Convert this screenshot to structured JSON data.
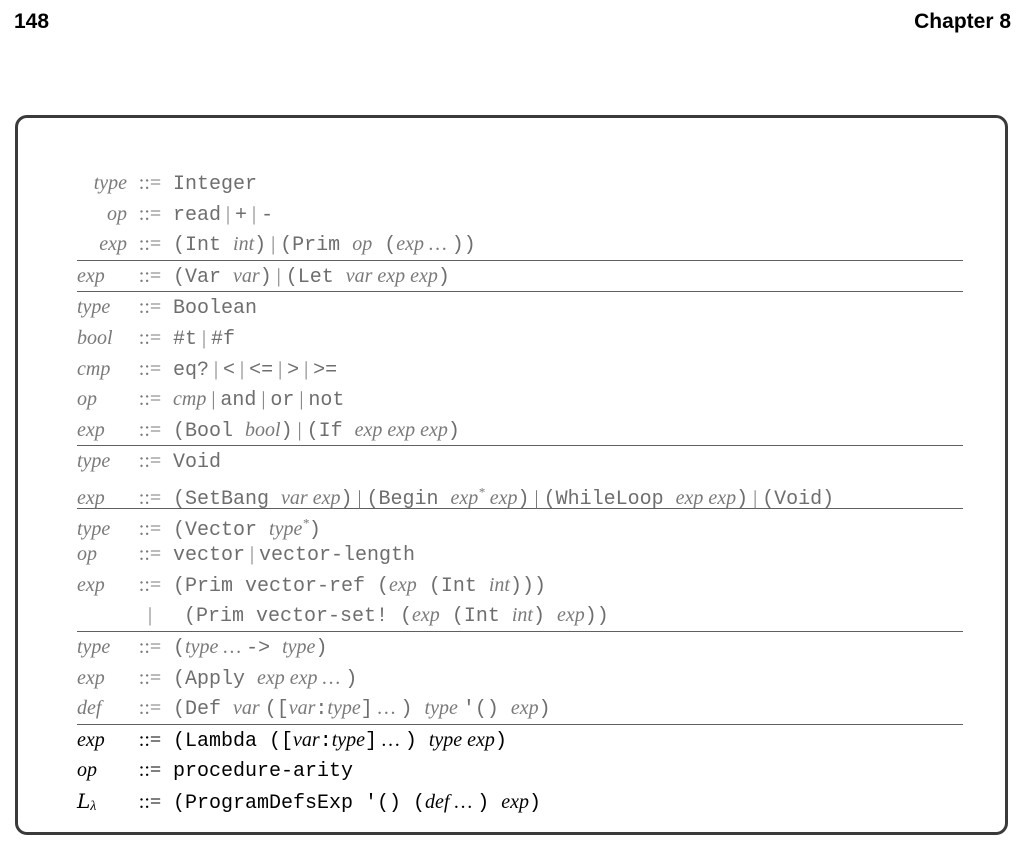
{
  "header": {
    "page_number": "148",
    "chapter": "Chapter 8"
  },
  "grammar": {
    "integers": [
      {
        "lhs": "type",
        "rhs": [
          [
            "mono",
            "Integer"
          ]
        ]
      },
      {
        "lhs": "op",
        "rhs": [
          [
            "mono",
            "read"
          ],
          [
            "sep",
            "|"
          ],
          [
            "mono",
            "+"
          ],
          [
            "sep",
            "|"
          ],
          [
            "mono",
            "-"
          ]
        ]
      },
      {
        "lhs": "exp",
        "rhs": [
          [
            "mono",
            "(Int "
          ],
          [
            "it",
            "int"
          ],
          [
            "mono",
            ")"
          ],
          [
            "sep",
            "|"
          ],
          [
            "mono",
            "(Prim "
          ],
          [
            "it",
            "op"
          ],
          [
            "mono",
            " ("
          ],
          [
            "it",
            "exp"
          ],
          [
            "it",
            " … "
          ],
          [
            "mono",
            "))"
          ]
        ]
      }
    ],
    "variables": [
      {
        "lhs": "exp",
        "rhs": [
          [
            "mono",
            "(Var "
          ],
          [
            "it",
            "var"
          ],
          [
            "mono",
            ")"
          ],
          [
            "sep",
            "|"
          ],
          [
            "mono",
            "(Let "
          ],
          [
            "it",
            "var exp exp"
          ],
          [
            "mono",
            ")"
          ]
        ]
      }
    ],
    "booleans": [
      {
        "lhs": "type",
        "rhs": [
          [
            "mono",
            "Boolean"
          ]
        ]
      },
      {
        "lhs": "bool",
        "rhs": [
          [
            "mono",
            "#t"
          ],
          [
            "sep",
            "|"
          ],
          [
            "mono",
            "#f"
          ]
        ]
      },
      {
        "lhs": "cmp",
        "rhs": [
          [
            "mono",
            "eq?"
          ],
          [
            "sep",
            "|"
          ],
          [
            "mono",
            "<"
          ],
          [
            "sep",
            "|"
          ],
          [
            "mono",
            "<="
          ],
          [
            "sep",
            "|"
          ],
          [
            "mono",
            ">"
          ],
          [
            "sep",
            "|"
          ],
          [
            "mono",
            ">="
          ]
        ]
      },
      {
        "lhs": "op",
        "rhs": [
          [
            "it",
            "cmp"
          ],
          [
            "sep",
            "|"
          ],
          [
            "mono",
            "and"
          ],
          [
            "sep",
            "|"
          ],
          [
            "mono",
            "or"
          ],
          [
            "sep",
            "|"
          ],
          [
            "mono",
            "not"
          ]
        ]
      },
      {
        "lhs": "exp",
        "rhs": [
          [
            "mono",
            "(Bool "
          ],
          [
            "it",
            "bool"
          ],
          [
            "mono",
            ")"
          ],
          [
            "sep",
            "|"
          ],
          [
            "mono",
            "(If "
          ],
          [
            "it",
            "exp exp exp"
          ],
          [
            "mono",
            ")"
          ]
        ]
      }
    ],
    "mutation": [
      {
        "lhs": "type",
        "rhs": [
          [
            "mono",
            "Void"
          ]
        ]
      },
      {
        "lhs": "exp",
        "rhs": [
          [
            "mono",
            "(SetBang "
          ],
          [
            "it",
            "var exp"
          ],
          [
            "mono",
            ")"
          ],
          [
            "sep",
            "|"
          ],
          [
            "mono",
            "(Begin "
          ],
          [
            "it",
            "exp"
          ],
          [
            "sup",
            "*"
          ],
          [
            "it",
            " exp"
          ],
          [
            "mono",
            ")"
          ],
          [
            "sep",
            "|"
          ],
          [
            "mono",
            "(WhileLoop "
          ],
          [
            "it",
            "exp exp"
          ],
          [
            "mono",
            ")"
          ],
          [
            "sep",
            "|"
          ],
          [
            "mono",
            "(Void)"
          ]
        ]
      }
    ],
    "vectors": [
      {
        "lhs": "type",
        "rhs": [
          [
            "mono",
            "(Vector "
          ],
          [
            "it",
            "type"
          ],
          [
            "sup",
            "*"
          ],
          [
            "mono",
            ")"
          ]
        ]
      },
      {
        "lhs": "op",
        "rhs": [
          [
            "mono",
            "vector"
          ],
          [
            "sep",
            "|"
          ],
          [
            "mono",
            "vector-length"
          ]
        ]
      },
      {
        "lhs": "exp",
        "rhs": [
          [
            "mono",
            "(Prim vector-ref ("
          ],
          [
            "it",
            "exp"
          ],
          [
            "mono",
            " (Int "
          ],
          [
            "it",
            "int"
          ],
          [
            "mono",
            ")))"
          ]
        ]
      },
      {
        "lhs": "|",
        "rhs": [
          [
            "mono",
            "(Prim vector-set! ("
          ],
          [
            "it",
            "exp"
          ],
          [
            "mono",
            " (Int "
          ],
          [
            "it",
            "int"
          ],
          [
            "mono",
            ") "
          ],
          [
            "it",
            "exp"
          ],
          [
            "mono",
            "))"
          ]
        ]
      }
    ],
    "functions": [
      {
        "lhs": "type",
        "rhs": [
          [
            "mono",
            "("
          ],
          [
            "it",
            "type … "
          ],
          [
            "mono",
            "-> "
          ],
          [
            "it",
            "type"
          ],
          [
            "mono",
            ")"
          ]
        ]
      },
      {
        "lhs": "exp",
        "rhs": [
          [
            "mono",
            "(Apply "
          ],
          [
            "it",
            "exp exp … "
          ],
          [
            "mono",
            ")"
          ]
        ]
      },
      {
        "lhs": "def",
        "rhs": [
          [
            "mono",
            "(Def "
          ],
          [
            "it",
            "var "
          ],
          [
            "mono",
            "(["
          ],
          [
            "it",
            "var"
          ],
          [
            "mono",
            ":"
          ],
          [
            "it",
            "type"
          ],
          [
            "mono",
            "]"
          ],
          [
            "it",
            " … "
          ],
          [
            "mono",
            ") "
          ],
          [
            "it",
            "type "
          ],
          [
            "mono",
            "'() "
          ],
          [
            "it",
            "exp"
          ],
          [
            "mono",
            ")"
          ]
        ]
      }
    ],
    "lambda": [
      {
        "lhs": "exp",
        "rhs": [
          [
            "mono",
            "(Lambda (["
          ],
          [
            "it",
            "var"
          ],
          [
            "mono",
            ":"
          ],
          [
            "it",
            "type"
          ],
          [
            "mono",
            "]"
          ],
          [
            "it",
            " … "
          ],
          [
            "mono",
            ") "
          ],
          [
            "it",
            "type exp"
          ],
          [
            "mono",
            ")"
          ]
        ]
      },
      {
        "lhs": "op",
        "rhs": [
          [
            "mono",
            "procedure-arity"
          ]
        ]
      },
      {
        "lhs": "Lλ",
        "rhs": [
          [
            "mono",
            "(ProgramDefsExp '() ("
          ],
          [
            "it",
            "def … "
          ],
          [
            "mono",
            ") "
          ],
          [
            "it",
            "exp"
          ],
          [
            "mono",
            ")"
          ]
        ]
      }
    ],
    "symbol": "::="
  }
}
